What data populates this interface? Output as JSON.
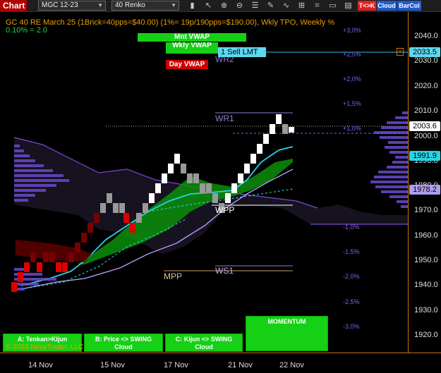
{
  "toolbar": {
    "title": "Chart",
    "instrument": "MGC 12-23",
    "bar_type": "40 Renko",
    "icons": [
      "bar-chart-icon",
      "pointer-icon",
      "zoom-in-icon",
      "zoom-out-icon",
      "properties-icon",
      "draw-icon",
      "indicator-icon",
      "strategy-icon",
      "window-icon"
    ],
    "tk_label": "T<>K",
    "cloud_label": "Cloud",
    "barcol_label": "BarCol",
    "colors": {
      "tk": "#e02020",
      "cloud": "#1e5ad0",
      "barcol": "#1e5ad0"
    }
  },
  "header": {
    "line1": "GC 40 RE March 25 (1Brick=40pps=$40.00)  (1%= 19p/190pps=$190.00), Wkly TPO, Weekly %",
    "line2": "0.10% = 2.0"
  },
  "percent_labels": [
    "+3,0%",
    "+2,5%",
    "+2,0%",
    "+1,5%",
    "+1,0%",
    "-1,0%",
    "-1,5%",
    "-2,0%",
    "-2,5%",
    "-3,0%"
  ],
  "price_ticks": [
    "2040.0",
    "2030.0",
    "2020.0",
    "2010.0",
    "2000.0",
    "1990.0",
    "1980.0",
    "1970.0",
    "1960.0",
    "1950.0",
    "1940.0",
    "1930.0",
    "1920.0"
  ],
  "price_boxes": {
    "sell_limit_price": "2033.5",
    "last_price": "2003.6",
    "level_1": "1991.9",
    "level_2": "1978.2"
  },
  "order": {
    "label": "1 Sell LMT",
    "close_icon": "close-icon"
  },
  "levels": {
    "wr1": "WR1",
    "wr2": "WR2",
    "wpp": "WPP",
    "ws1": "WS1",
    "mpp": "MPP"
  },
  "vwap": {
    "monthly": "Mnt VWAP",
    "weekly": "Wkly VWAP",
    "daily": "Day VWAP"
  },
  "panels": {
    "a": "A: Tenkan>Kijun",
    "b_line1": "B: Price <> SWING",
    "b_line2": "Cloud",
    "c_line1": "C: Kijun <> SWING",
    "c_line2": "Cloud",
    "momentum": "MOMENTUM"
  },
  "copyright": "© 2023 NinjaTrader, LLC",
  "time_labels": [
    "14 Nov",
    "15 Nov",
    "17 Nov",
    "21 Nov",
    "22 Nov"
  ],
  "colors": {
    "accent": "#cc7700",
    "bull": "#ffffff",
    "bear": "#dd0000",
    "pct": "#8a5cf5",
    "cloud": "#1a1528",
    "kumo_green": "#0b8f0b",
    "cyan": "#2ee6e6"
  }
}
